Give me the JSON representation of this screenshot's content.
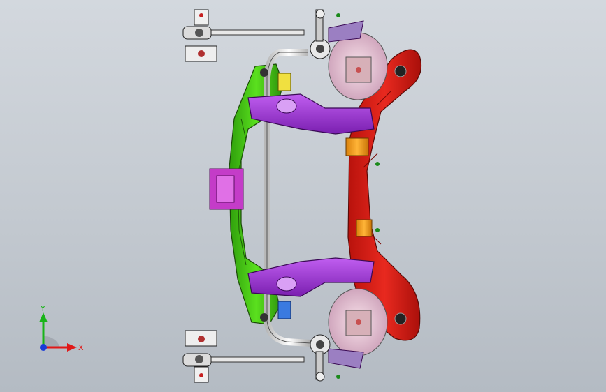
{
  "viewport": {
    "background_top": "#d3d8de",
    "background_bottom": "#b4bbc3"
  },
  "model": {
    "parts": [
      {
        "name": "subframe-cross-member",
        "color": "#e2231a"
      },
      {
        "name": "subframe-side-rail",
        "color": "#4bd415"
      },
      {
        "name": "control-arm",
        "color": "#9b30d8"
      },
      {
        "name": "stabilizer-bar",
        "color": "#f2f2f2"
      },
      {
        "name": "body-mount-bushing",
        "color": "#f29a1a"
      },
      {
        "name": "spring-seat",
        "color": "#f2c8d2"
      },
      {
        "name": "center-bracket",
        "color": "#c43cc8"
      }
    ]
  },
  "triad": {
    "x_label": "X",
    "y_label": "Y",
    "x_color": "#e01818",
    "y_color": "#18b418",
    "z_color": "#1a3cd8"
  }
}
